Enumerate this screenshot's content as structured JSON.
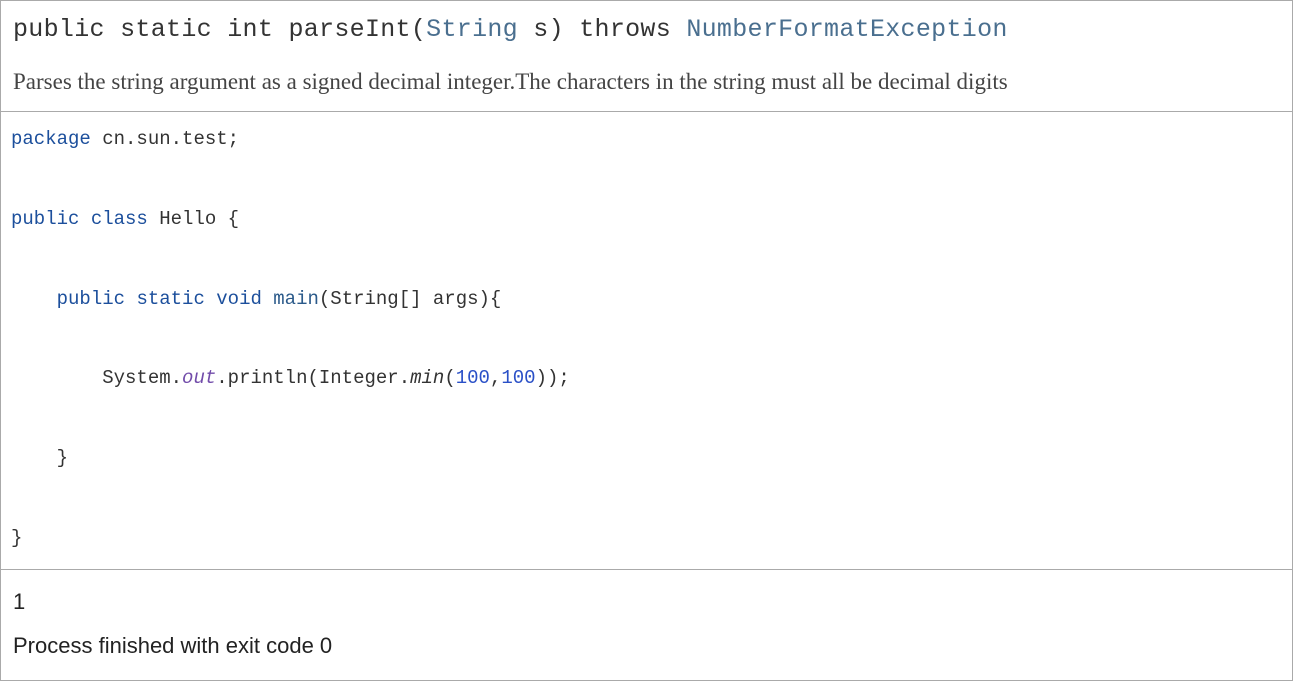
{
  "signature": {
    "prefix": "public static int parseInt(",
    "paramType": "String",
    "paramName": " s) throws ",
    "exceptionType": "NumberFormatException"
  },
  "description": "Parses the string argument as a signed decimal integer.The characters in the string must all be decimal digits",
  "code": {
    "line1_kw": "package",
    "line1_rest": " cn.sun.test;",
    "line2_kw1": "public",
    "line2_kw2": "class",
    "line2_rest": " Hello {",
    "line3_indent": "    ",
    "line3_kw1": "public",
    "line3_kw2": "static",
    "line3_kw3": "void",
    "line3_main": "main",
    "line3_rest": "(String[] args){",
    "line4_indent": "        ",
    "line4_pre": "System.",
    "line4_out": "out",
    "line4_mid": ".println(Integer.",
    "line4_min": "min",
    "line4_open": "(",
    "line4_num1": "100",
    "line4_comma": ",",
    "line4_num2": "100",
    "line4_close": "));",
    "line5_indent": "    ",
    "line5_brace": "}",
    "line6_brace": "}"
  },
  "output": {
    "line1": "1",
    "line2": "Process finished with exit code 0"
  }
}
